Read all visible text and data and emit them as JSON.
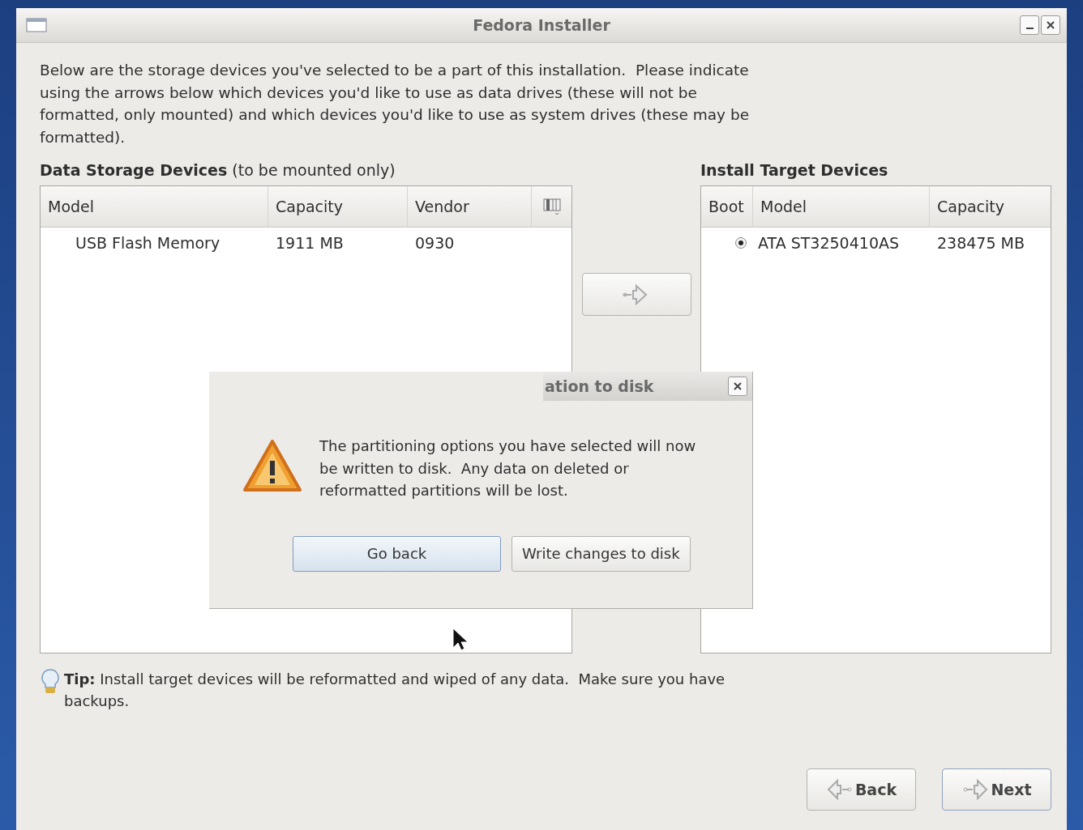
{
  "window": {
    "title": "Fedora Installer"
  },
  "intro": "Below are the storage devices you've selected to be a part of this installation.  Please indicate using the arrows below which devices you'd like to use as data drives (these will not be formatted, only mounted) and which devices you'd like to use as system drives (these may be formatted).",
  "data_storage": {
    "heading": "Data Storage Devices",
    "note": "(to be mounted only)",
    "columns": [
      "Model",
      "Capacity",
      "Vendor"
    ],
    "rows": [
      {
        "cells": [
          "USB Flash Memory",
          "1911 MB",
          "0930"
        ]
      }
    ]
  },
  "install_target": {
    "heading": "Install Target Devices",
    "columns": [
      "Boot",
      "Model",
      "Capacity"
    ],
    "rows": [
      {
        "boot": true,
        "model": "ATA ST3250410AS",
        "capacity": "238475 MB"
      }
    ]
  },
  "tip": "**Tip:** Install target devices will be reformatted and wiped of any data.  Make sure you have backups.",
  "dialog": {
    "title": "ation to disk",
    "message": "The partitioning options you have selected will now be written to disk.  Any data on deleted or reformatted partitions will be lost.",
    "buttons": [
      {
        "label": "Go back",
        "default": true
      },
      {
        "label": "Write changes to disk",
        "default": false
      }
    ]
  },
  "nav_buttons": [
    {
      "label": "Back",
      "kind": "back"
    },
    {
      "label": "Next",
      "kind": "next"
    }
  ]
}
